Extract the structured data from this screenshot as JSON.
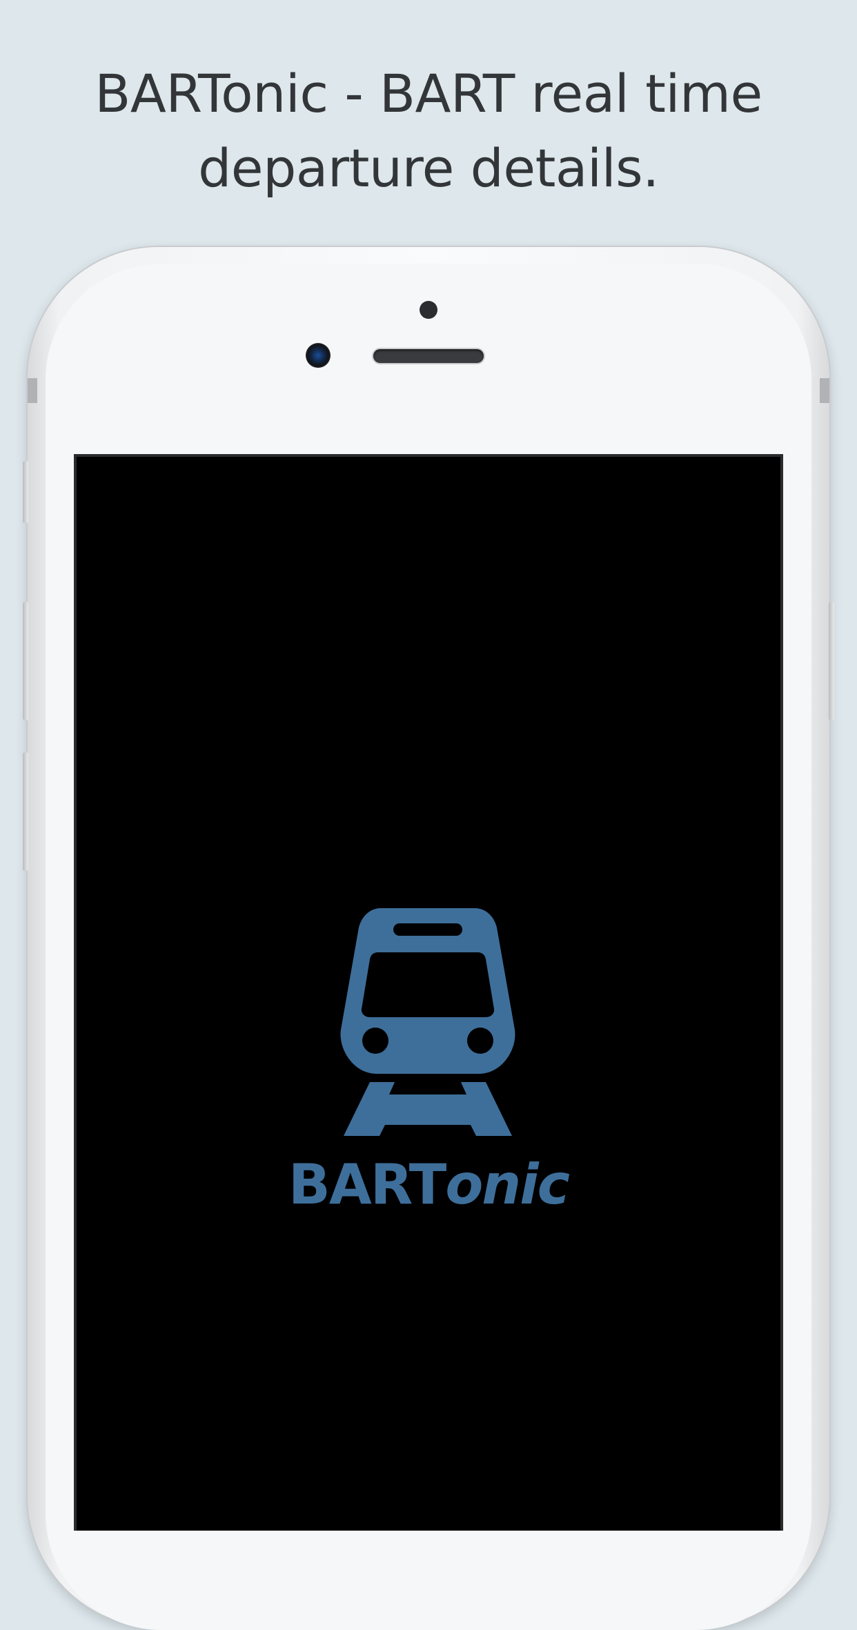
{
  "caption": {
    "line1": "BARTonic - BART real time",
    "line2": "departure details."
  },
  "splash": {
    "logo_icon": "train-icon",
    "logo_text_plain": "BART",
    "logo_text_italic": "onic"
  },
  "colors": {
    "background": "#dde7ec",
    "caption_text": "#333638",
    "brand_blue": "#3e6f9b",
    "screen": "#000000"
  }
}
